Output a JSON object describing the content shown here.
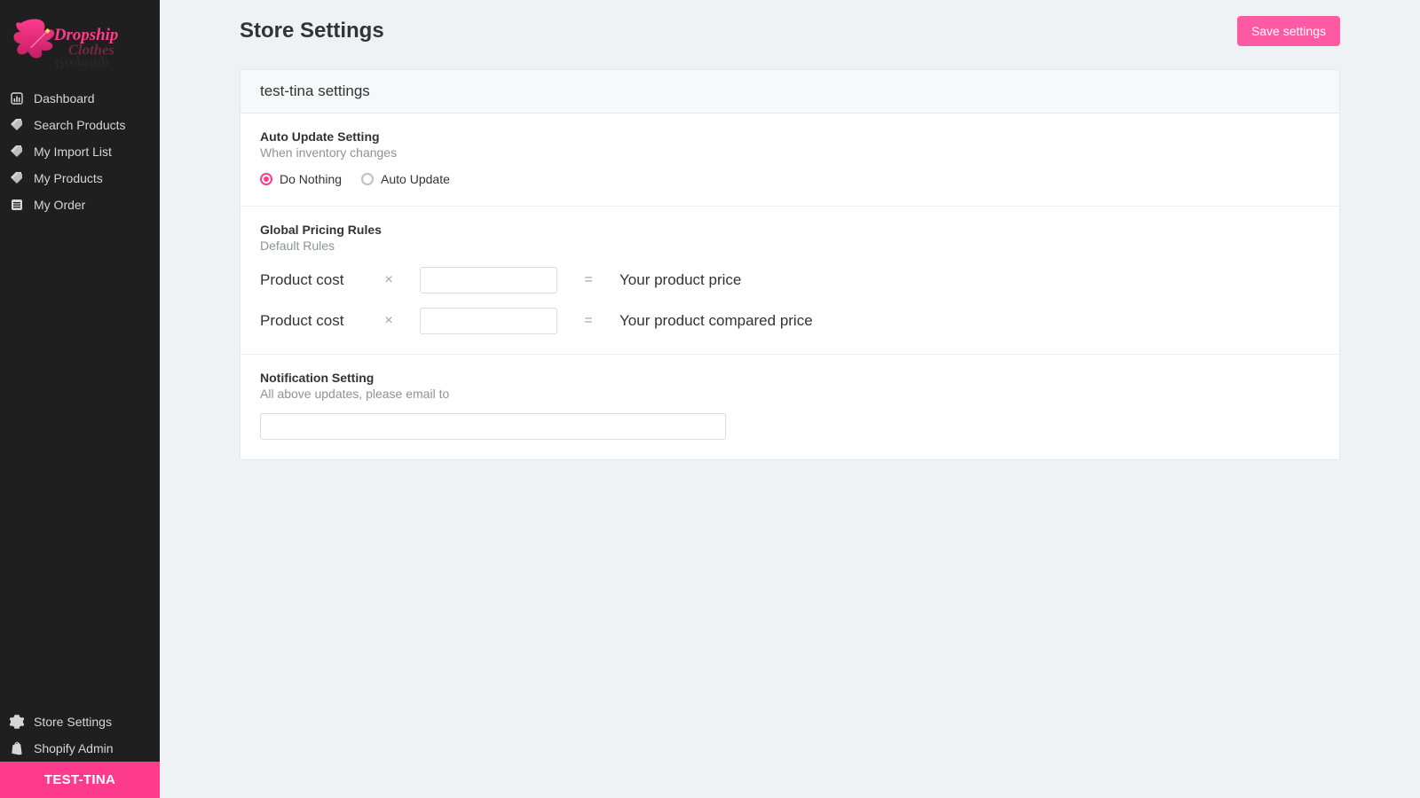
{
  "brand": {
    "text_top": "Dropship",
    "text_bottom": "Clothes"
  },
  "sidebar": {
    "items": [
      {
        "icon": "bars-icon",
        "label": "Dashboard"
      },
      {
        "icon": "tag-icon",
        "label": "Search Products"
      },
      {
        "icon": "tag-icon",
        "label": "My Import List"
      },
      {
        "icon": "tag-icon",
        "label": "My Products"
      },
      {
        "icon": "list-icon",
        "label": "My Order"
      }
    ],
    "bottom": [
      {
        "icon": "gear-icon",
        "label": "Store Settings"
      },
      {
        "icon": "shopify-icon",
        "label": "Shopify Admin"
      }
    ]
  },
  "store_badge": "TEST-TINA",
  "header": {
    "title": "Store Settings",
    "save_label": "Save settings"
  },
  "panel": {
    "title": "test-tina settings"
  },
  "auto_update": {
    "title": "Auto Update Setting",
    "subtitle": "When inventory changes",
    "options": [
      {
        "label": "Do Nothing",
        "selected": true
      },
      {
        "label": "Auto Update",
        "selected": false
      }
    ]
  },
  "pricing": {
    "title": "Global Pricing Rules",
    "subtitle": "Default Rules",
    "rows": [
      {
        "label": "Product cost",
        "value": "",
        "result": "Your product price"
      },
      {
        "label": "Product cost",
        "value": "",
        "result": "Your product compared price"
      }
    ],
    "multiply_glyph": "×",
    "equals_glyph": "="
  },
  "notification": {
    "title": "Notification Setting",
    "subtitle": "All above updates, please email to",
    "email": ""
  }
}
